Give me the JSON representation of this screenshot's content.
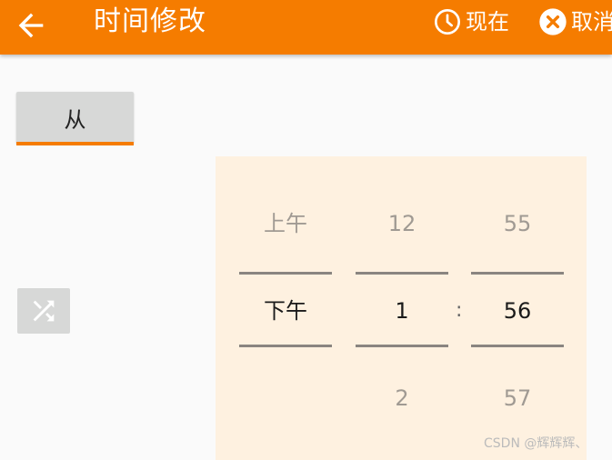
{
  "header": {
    "title": "时间修改",
    "now_label": "现在",
    "cancel_label": "取消"
  },
  "from_button": {
    "label": "从"
  },
  "picker": {
    "ampm": {
      "prev": "上午",
      "current": "下午",
      "next": ""
    },
    "hour": {
      "prev": "12",
      "current": "1",
      "next": "2"
    },
    "minute": {
      "prev": "55",
      "current": "56",
      "next": "57"
    },
    "separator": ":"
  },
  "watermark": "CSDN @辉辉辉、",
  "colors": {
    "accent": "#f57c00",
    "picker_bg": "#fef1e0",
    "button_bg": "#d7d8d7"
  },
  "icons": {
    "back": "arrow-left-icon",
    "now": "clock-icon",
    "cancel": "close-circle-icon",
    "shuffle": "shuffle-icon"
  }
}
